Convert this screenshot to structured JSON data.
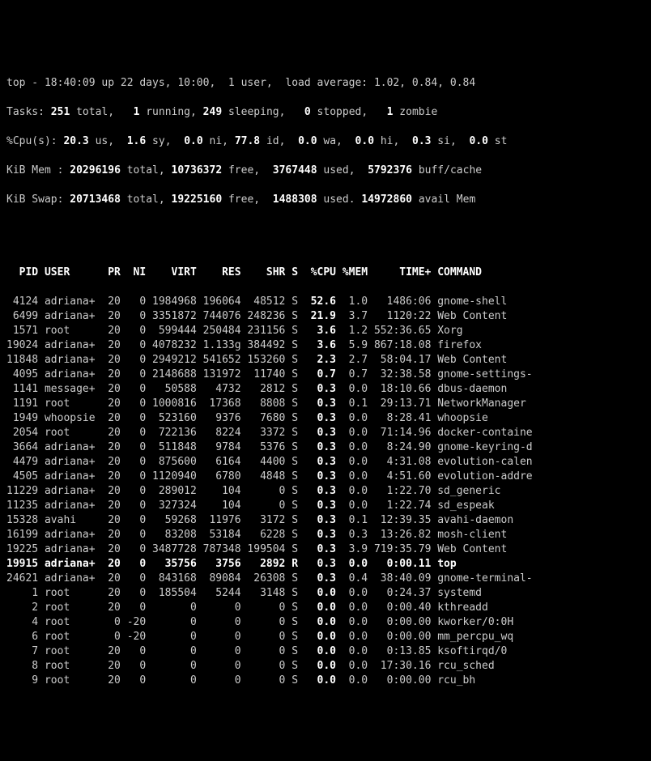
{
  "summary": {
    "line1_raw": "top - 18:40:09 up 22 days, 10:00,  1 user,  load average: 1.02, 0.84, 0.84",
    "tasks": {
      "total": "251",
      "running": "1",
      "sleeping": "249",
      "stopped": "0",
      "zombie": "1"
    },
    "cpu": {
      "us": "20.3",
      "sy": "1.6",
      "ni": "0.0",
      "id": "77.8",
      "wa": "0.0",
      "hi": "0.0",
      "si": "0.3",
      "st": "0.0"
    },
    "mem": {
      "total": "20296196",
      "free": "10736372",
      "used": "3767448",
      "buffcache": "5792376"
    },
    "swap": {
      "total": "20713468",
      "free": "19225160",
      "used": "1488308",
      "avail": "14972860"
    }
  },
  "columns": {
    "pid": "PID",
    "user": "USER",
    "pr": "PR",
    "ni": "NI",
    "virt": "VIRT",
    "res": "RES",
    "shr": "SHR",
    "s": "S",
    "cpu": "%CPU",
    "mem": "%MEM",
    "time": "TIME+",
    "cmd": "COMMAND"
  },
  "rows": [
    {
      "pid": "4124",
      "user": "adriana+",
      "pr": "20",
      "ni": "0",
      "virt": "1984968",
      "res": "196064",
      "shr": "48512",
      "s": "S",
      "cpu": "52.6",
      "mem": "1.0",
      "time": "1486:06",
      "cmd": "gnome-shell"
    },
    {
      "pid": "6499",
      "user": "adriana+",
      "pr": "20",
      "ni": "0",
      "virt": "3351872",
      "res": "744076",
      "shr": "248236",
      "s": "S",
      "cpu": "21.9",
      "mem": "3.7",
      "time": "1120:22",
      "cmd": "Web Content"
    },
    {
      "pid": "1571",
      "user": "root",
      "pr": "20",
      "ni": "0",
      "virt": "599444",
      "res": "250484",
      "shr": "231156",
      "s": "S",
      "cpu": "3.6",
      "mem": "1.2",
      "time": "552:36.65",
      "cmd": "Xorg"
    },
    {
      "pid": "19024",
      "user": "adriana+",
      "pr": "20",
      "ni": "0",
      "virt": "4078232",
      "res": "1.133g",
      "shr": "384492",
      "s": "S",
      "cpu": "3.6",
      "mem": "5.9",
      "time": "867:18.08",
      "cmd": "firefox"
    },
    {
      "pid": "11848",
      "user": "adriana+",
      "pr": "20",
      "ni": "0",
      "virt": "2949212",
      "res": "541652",
      "shr": "153260",
      "s": "S",
      "cpu": "2.3",
      "mem": "2.7",
      "time": "58:04.17",
      "cmd": "Web Content"
    },
    {
      "pid": "4095",
      "user": "adriana+",
      "pr": "20",
      "ni": "0",
      "virt": "2148688",
      "res": "131972",
      "shr": "11740",
      "s": "S",
      "cpu": "0.7",
      "mem": "0.7",
      "time": "32:38.58",
      "cmd": "gnome-settings-"
    },
    {
      "pid": "1141",
      "user": "message+",
      "pr": "20",
      "ni": "0",
      "virt": "50588",
      "res": "4732",
      "shr": "2812",
      "s": "S",
      "cpu": "0.3",
      "mem": "0.0",
      "time": "18:10.66",
      "cmd": "dbus-daemon"
    },
    {
      "pid": "1191",
      "user": "root",
      "pr": "20",
      "ni": "0",
      "virt": "1000816",
      "res": "17368",
      "shr": "8808",
      "s": "S",
      "cpu": "0.3",
      "mem": "0.1",
      "time": "29:13.71",
      "cmd": "NetworkManager"
    },
    {
      "pid": "1949",
      "user": "whoopsie",
      "pr": "20",
      "ni": "0",
      "virt": "523160",
      "res": "9376",
      "shr": "7680",
      "s": "S",
      "cpu": "0.3",
      "mem": "0.0",
      "time": "8:28.41",
      "cmd": "whoopsie"
    },
    {
      "pid": "2054",
      "user": "root",
      "pr": "20",
      "ni": "0",
      "virt": "722136",
      "res": "8224",
      "shr": "3372",
      "s": "S",
      "cpu": "0.3",
      "mem": "0.0",
      "time": "71:14.96",
      "cmd": "docker-containe"
    },
    {
      "pid": "3664",
      "user": "adriana+",
      "pr": "20",
      "ni": "0",
      "virt": "511848",
      "res": "9784",
      "shr": "5376",
      "s": "S",
      "cpu": "0.3",
      "mem": "0.0",
      "time": "8:24.90",
      "cmd": "gnome-keyring-d"
    },
    {
      "pid": "4479",
      "user": "adriana+",
      "pr": "20",
      "ni": "0",
      "virt": "875600",
      "res": "6164",
      "shr": "4400",
      "s": "S",
      "cpu": "0.3",
      "mem": "0.0",
      "time": "4:31.08",
      "cmd": "evolution-calen"
    },
    {
      "pid": "4505",
      "user": "adriana+",
      "pr": "20",
      "ni": "0",
      "virt": "1120940",
      "res": "6780",
      "shr": "4848",
      "s": "S",
      "cpu": "0.3",
      "mem": "0.0",
      "time": "4:51.60",
      "cmd": "evolution-addre"
    },
    {
      "pid": "11229",
      "user": "adriana+",
      "pr": "20",
      "ni": "0",
      "virt": "289012",
      "res": "104",
      "shr": "0",
      "s": "S",
      "cpu": "0.3",
      "mem": "0.0",
      "time": "1:22.70",
      "cmd": "sd_generic"
    },
    {
      "pid": "11235",
      "user": "adriana+",
      "pr": "20",
      "ni": "0",
      "virt": "327324",
      "res": "104",
      "shr": "0",
      "s": "S",
      "cpu": "0.3",
      "mem": "0.0",
      "time": "1:22.74",
      "cmd": "sd_espeak"
    },
    {
      "pid": "15328",
      "user": "avahi",
      "pr": "20",
      "ni": "0",
      "virt": "59268",
      "res": "11976",
      "shr": "3172",
      "s": "S",
      "cpu": "0.3",
      "mem": "0.1",
      "time": "12:39.35",
      "cmd": "avahi-daemon"
    },
    {
      "pid": "16199",
      "user": "adriana+",
      "pr": "20",
      "ni": "0",
      "virt": "83208",
      "res": "53184",
      "shr": "6228",
      "s": "S",
      "cpu": "0.3",
      "mem": "0.3",
      "time": "13:26.82",
      "cmd": "mosh-client"
    },
    {
      "pid": "19225",
      "user": "adriana+",
      "pr": "20",
      "ni": "0",
      "virt": "3487728",
      "res": "787348",
      "shr": "199504",
      "s": "S",
      "cpu": "0.3",
      "mem": "3.9",
      "time": "719:35.79",
      "cmd": "Web Content"
    },
    {
      "pid": "19915",
      "user": "adriana+",
      "pr": "20",
      "ni": "0",
      "virt": "35756",
      "res": "3756",
      "shr": "2892",
      "s": "R",
      "cpu": "0.3",
      "mem": "0.0",
      "time": "0:00.11",
      "cmd": "top",
      "highlight": true
    },
    {
      "pid": "24621",
      "user": "adriana+",
      "pr": "20",
      "ni": "0",
      "virt": "843168",
      "res": "89084",
      "shr": "26308",
      "s": "S",
      "cpu": "0.3",
      "mem": "0.4",
      "time": "38:40.09",
      "cmd": "gnome-terminal-"
    },
    {
      "pid": "1",
      "user": "root",
      "pr": "20",
      "ni": "0",
      "virt": "185504",
      "res": "5244",
      "shr": "3148",
      "s": "S",
      "cpu": "0.0",
      "mem": "0.0",
      "time": "0:24.37",
      "cmd": "systemd"
    },
    {
      "pid": "2",
      "user": "root",
      "pr": "20",
      "ni": "0",
      "virt": "0",
      "res": "0",
      "shr": "0",
      "s": "S",
      "cpu": "0.0",
      "mem": "0.0",
      "time": "0:00.40",
      "cmd": "kthreadd"
    },
    {
      "pid": "4",
      "user": "root",
      "pr": "0",
      "ni": "-20",
      "virt": "0",
      "res": "0",
      "shr": "0",
      "s": "S",
      "cpu": "0.0",
      "mem": "0.0",
      "time": "0:00.00",
      "cmd": "kworker/0:0H"
    },
    {
      "pid": "6",
      "user": "root",
      "pr": "0",
      "ni": "-20",
      "virt": "0",
      "res": "0",
      "shr": "0",
      "s": "S",
      "cpu": "0.0",
      "mem": "0.0",
      "time": "0:00.00",
      "cmd": "mm_percpu_wq"
    },
    {
      "pid": "7",
      "user": "root",
      "pr": "20",
      "ni": "0",
      "virt": "0",
      "res": "0",
      "shr": "0",
      "s": "S",
      "cpu": "0.0",
      "mem": "0.0",
      "time": "0:13.85",
      "cmd": "ksoftirqd/0"
    },
    {
      "pid": "8",
      "user": "root",
      "pr": "20",
      "ni": "0",
      "virt": "0",
      "res": "0",
      "shr": "0",
      "s": "S",
      "cpu": "0.0",
      "mem": "0.0",
      "time": "17:30.16",
      "cmd": "rcu_sched"
    },
    {
      "pid": "9",
      "user": "root",
      "pr": "20",
      "ni": "0",
      "virt": "0",
      "res": "0",
      "shr": "0",
      "s": "S",
      "cpu": "0.0",
      "mem": "0.0",
      "time": "0:00.00",
      "cmd": "rcu_bh"
    }
  ]
}
